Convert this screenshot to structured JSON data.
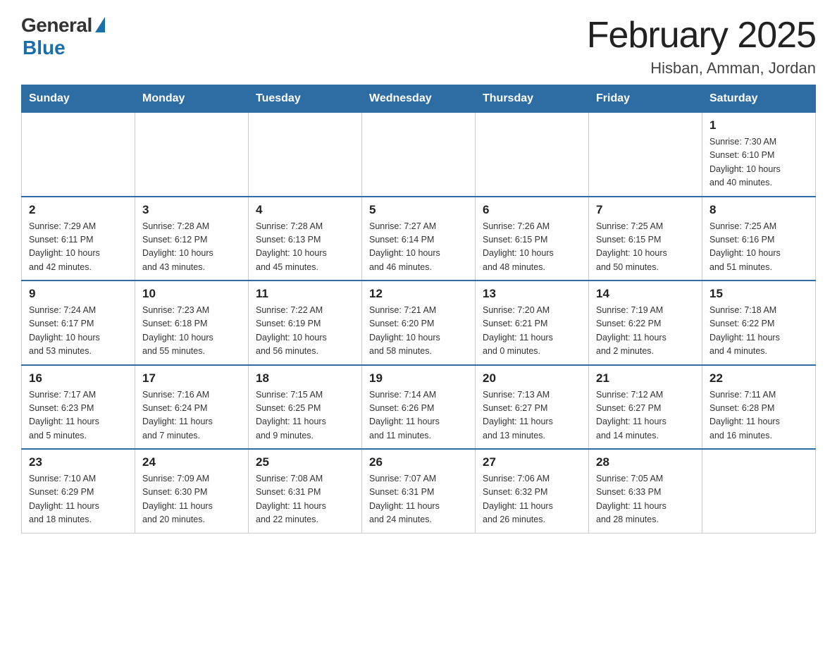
{
  "header": {
    "logo_general": "General",
    "logo_blue": "Blue",
    "month_title": "February 2025",
    "location": "Hisban, Amman, Jordan"
  },
  "weekdays": [
    "Sunday",
    "Monday",
    "Tuesday",
    "Wednesday",
    "Thursday",
    "Friday",
    "Saturday"
  ],
  "weeks": [
    [
      {
        "day": "",
        "info": ""
      },
      {
        "day": "",
        "info": ""
      },
      {
        "day": "",
        "info": ""
      },
      {
        "day": "",
        "info": ""
      },
      {
        "day": "",
        "info": ""
      },
      {
        "day": "",
        "info": ""
      },
      {
        "day": "1",
        "info": "Sunrise: 7:30 AM\nSunset: 6:10 PM\nDaylight: 10 hours\nand 40 minutes."
      }
    ],
    [
      {
        "day": "2",
        "info": "Sunrise: 7:29 AM\nSunset: 6:11 PM\nDaylight: 10 hours\nand 42 minutes."
      },
      {
        "day": "3",
        "info": "Sunrise: 7:28 AM\nSunset: 6:12 PM\nDaylight: 10 hours\nand 43 minutes."
      },
      {
        "day": "4",
        "info": "Sunrise: 7:28 AM\nSunset: 6:13 PM\nDaylight: 10 hours\nand 45 minutes."
      },
      {
        "day": "5",
        "info": "Sunrise: 7:27 AM\nSunset: 6:14 PM\nDaylight: 10 hours\nand 46 minutes."
      },
      {
        "day": "6",
        "info": "Sunrise: 7:26 AM\nSunset: 6:15 PM\nDaylight: 10 hours\nand 48 minutes."
      },
      {
        "day": "7",
        "info": "Sunrise: 7:25 AM\nSunset: 6:15 PM\nDaylight: 10 hours\nand 50 minutes."
      },
      {
        "day": "8",
        "info": "Sunrise: 7:25 AM\nSunset: 6:16 PM\nDaylight: 10 hours\nand 51 minutes."
      }
    ],
    [
      {
        "day": "9",
        "info": "Sunrise: 7:24 AM\nSunset: 6:17 PM\nDaylight: 10 hours\nand 53 minutes."
      },
      {
        "day": "10",
        "info": "Sunrise: 7:23 AM\nSunset: 6:18 PM\nDaylight: 10 hours\nand 55 minutes."
      },
      {
        "day": "11",
        "info": "Sunrise: 7:22 AM\nSunset: 6:19 PM\nDaylight: 10 hours\nand 56 minutes."
      },
      {
        "day": "12",
        "info": "Sunrise: 7:21 AM\nSunset: 6:20 PM\nDaylight: 10 hours\nand 58 minutes."
      },
      {
        "day": "13",
        "info": "Sunrise: 7:20 AM\nSunset: 6:21 PM\nDaylight: 11 hours\nand 0 minutes."
      },
      {
        "day": "14",
        "info": "Sunrise: 7:19 AM\nSunset: 6:22 PM\nDaylight: 11 hours\nand 2 minutes."
      },
      {
        "day": "15",
        "info": "Sunrise: 7:18 AM\nSunset: 6:22 PM\nDaylight: 11 hours\nand 4 minutes."
      }
    ],
    [
      {
        "day": "16",
        "info": "Sunrise: 7:17 AM\nSunset: 6:23 PM\nDaylight: 11 hours\nand 5 minutes."
      },
      {
        "day": "17",
        "info": "Sunrise: 7:16 AM\nSunset: 6:24 PM\nDaylight: 11 hours\nand 7 minutes."
      },
      {
        "day": "18",
        "info": "Sunrise: 7:15 AM\nSunset: 6:25 PM\nDaylight: 11 hours\nand 9 minutes."
      },
      {
        "day": "19",
        "info": "Sunrise: 7:14 AM\nSunset: 6:26 PM\nDaylight: 11 hours\nand 11 minutes."
      },
      {
        "day": "20",
        "info": "Sunrise: 7:13 AM\nSunset: 6:27 PM\nDaylight: 11 hours\nand 13 minutes."
      },
      {
        "day": "21",
        "info": "Sunrise: 7:12 AM\nSunset: 6:27 PM\nDaylight: 11 hours\nand 14 minutes."
      },
      {
        "day": "22",
        "info": "Sunrise: 7:11 AM\nSunset: 6:28 PM\nDaylight: 11 hours\nand 16 minutes."
      }
    ],
    [
      {
        "day": "23",
        "info": "Sunrise: 7:10 AM\nSunset: 6:29 PM\nDaylight: 11 hours\nand 18 minutes."
      },
      {
        "day": "24",
        "info": "Sunrise: 7:09 AM\nSunset: 6:30 PM\nDaylight: 11 hours\nand 20 minutes."
      },
      {
        "day": "25",
        "info": "Sunrise: 7:08 AM\nSunset: 6:31 PM\nDaylight: 11 hours\nand 22 minutes."
      },
      {
        "day": "26",
        "info": "Sunrise: 7:07 AM\nSunset: 6:31 PM\nDaylight: 11 hours\nand 24 minutes."
      },
      {
        "day": "27",
        "info": "Sunrise: 7:06 AM\nSunset: 6:32 PM\nDaylight: 11 hours\nand 26 minutes."
      },
      {
        "day": "28",
        "info": "Sunrise: 7:05 AM\nSunset: 6:33 PM\nDaylight: 11 hours\nand 28 minutes."
      },
      {
        "day": "",
        "info": ""
      }
    ]
  ]
}
